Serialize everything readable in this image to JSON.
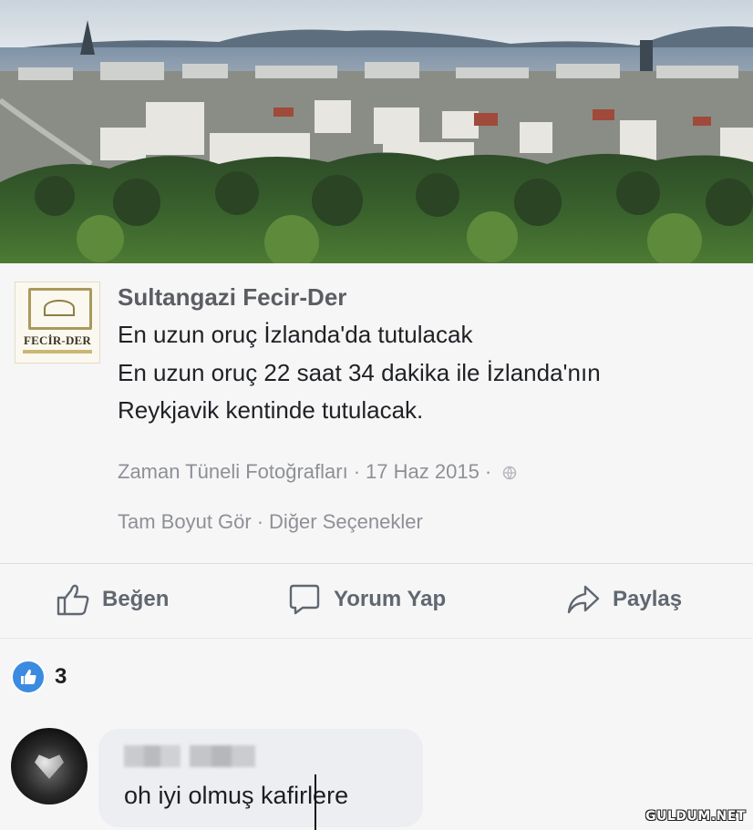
{
  "post": {
    "author": "Sultangazi Fecir-Der",
    "logo_text": "FECİR-DER",
    "message_lines": [
      "En uzun oruç İzlanda'da tutulacak",
      "En uzun oruç 22 saat 34 dakika ile İzlanda'nın",
      "Reykjavik kentinde tutulacak."
    ],
    "album": "Zaman Tüneli Fotoğrafları",
    "date": "17 Haz 2015",
    "separator": "·",
    "full_size_link": "Tam Boyut Gör",
    "more_options_link": "Diğer Seçenekler"
  },
  "actions": {
    "like": "Beğen",
    "comment": "Yorum Yap",
    "share": "Paylaş"
  },
  "reactions": {
    "count": "3",
    "icon": "like-thumb-icon",
    "color": "#3b8be0"
  },
  "comment": {
    "text": "oh iyi olmuş kafirlere"
  },
  "watermark": "GULDUM.NET"
}
